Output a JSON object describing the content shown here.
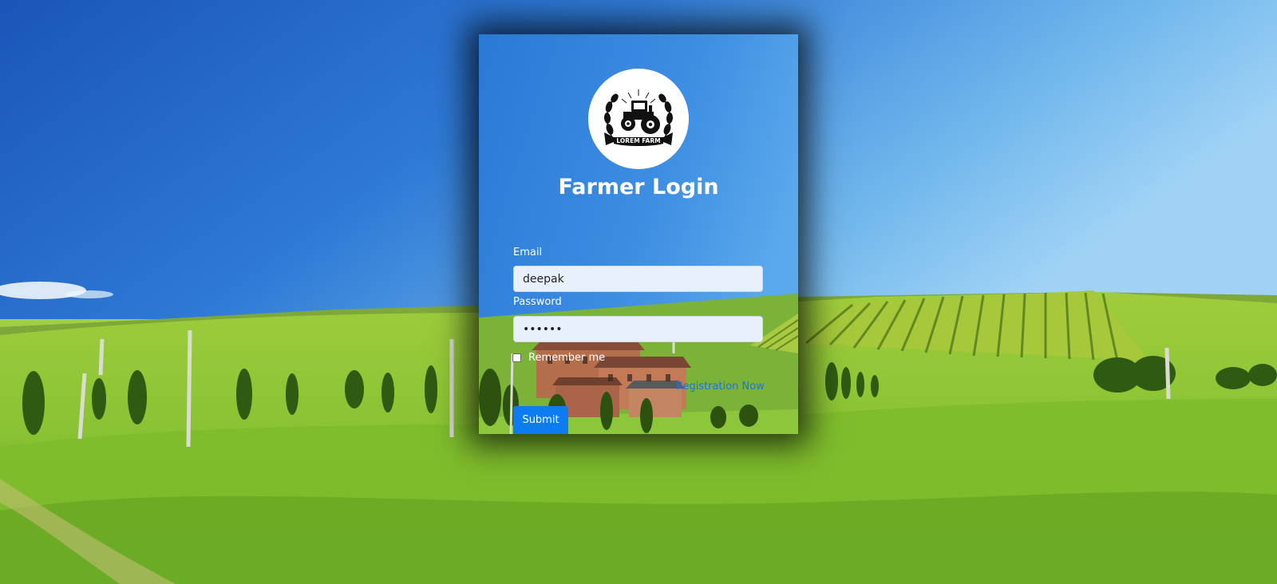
{
  "login": {
    "title": "Farmer Login",
    "logo_text": "LOREM FARM",
    "email_label": "Email",
    "email_value": "deepak",
    "password_label": "Password",
    "password_value": "••••••",
    "remember_label": "Remember me",
    "remember_checked": false,
    "registration_link": "Registration Now",
    "submit_label": "Submit"
  },
  "colors": {
    "accent": "#0d7bf2",
    "link": "#1a73e8",
    "input_bg": "#e8f0fe",
    "card_sky": "#4a9ae4"
  },
  "icons": [
    "tractor-logo-icon",
    "checkbox-icon"
  ]
}
